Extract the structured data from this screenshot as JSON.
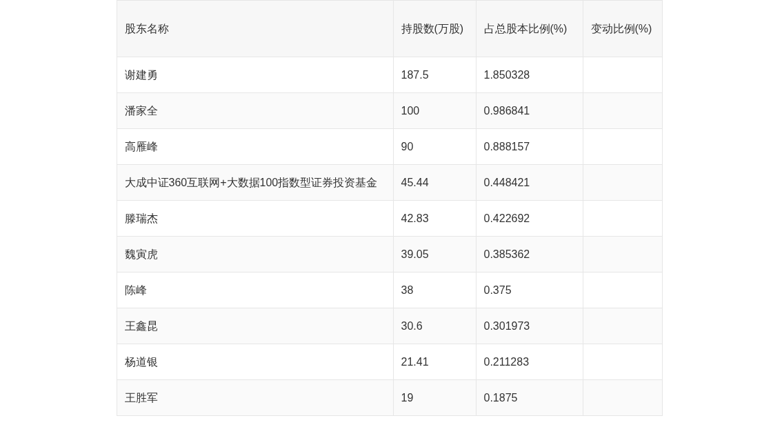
{
  "table": {
    "columns": [
      "股东名称",
      "持股数(万股)",
      "占总股本比例(%)",
      "变动比例(%)"
    ],
    "rows": [
      [
        "谢建勇",
        "187.5",
        "1.850328",
        ""
      ],
      [
        "潘家全",
        "100",
        "0.986841",
        ""
      ],
      [
        "高雁峰",
        "90",
        "0.888157",
        ""
      ],
      [
        "大成中证360互联网+大数据100指数型证券投资基金",
        "45.44",
        "0.448421",
        ""
      ],
      [
        "滕瑞杰",
        "42.83",
        "0.422692",
        ""
      ],
      [
        "魏寅虎",
        "39.05",
        "0.385362",
        ""
      ],
      [
        "陈峰",
        "38",
        "0.375",
        ""
      ],
      [
        "王鑫昆",
        "30.6",
        "0.301973",
        ""
      ],
      [
        "杨道银",
        "21.41",
        "0.211283",
        ""
      ],
      [
        "王胜军",
        "19",
        "0.1875",
        ""
      ]
    ]
  }
}
